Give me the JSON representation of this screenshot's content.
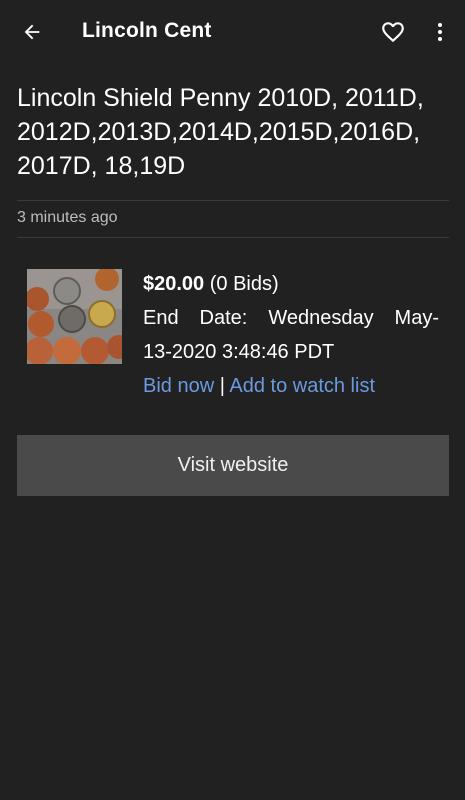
{
  "app_bar": {
    "title": "Lincoln Cent",
    "back_icon": "arrow-left-icon",
    "favorite_icon": "heart-outline-icon",
    "more_icon": "more-vertical-icon"
  },
  "listing": {
    "title": "Lincoln Shield Penny 2010D, 2011D, 2012D,2013D,2014D,2015D,2016D, 2017D, 18,19D",
    "posted": "3 minutes ago",
    "price": "$20.00",
    "bids": "(0 Bids)",
    "end_date_label": "End Date:",
    "end_date_line1_value": "Wednesday May-",
    "end_date_line2": "13-2020 3:48:46 PDT",
    "bid_now": "Bid now",
    "separator": "|",
    "watch_list": "Add to watch list"
  },
  "visit_button": {
    "label": "Visit website"
  },
  "colors": {
    "background": "#212121",
    "link": "#6b9ae0",
    "button": "#4a4a4a"
  }
}
